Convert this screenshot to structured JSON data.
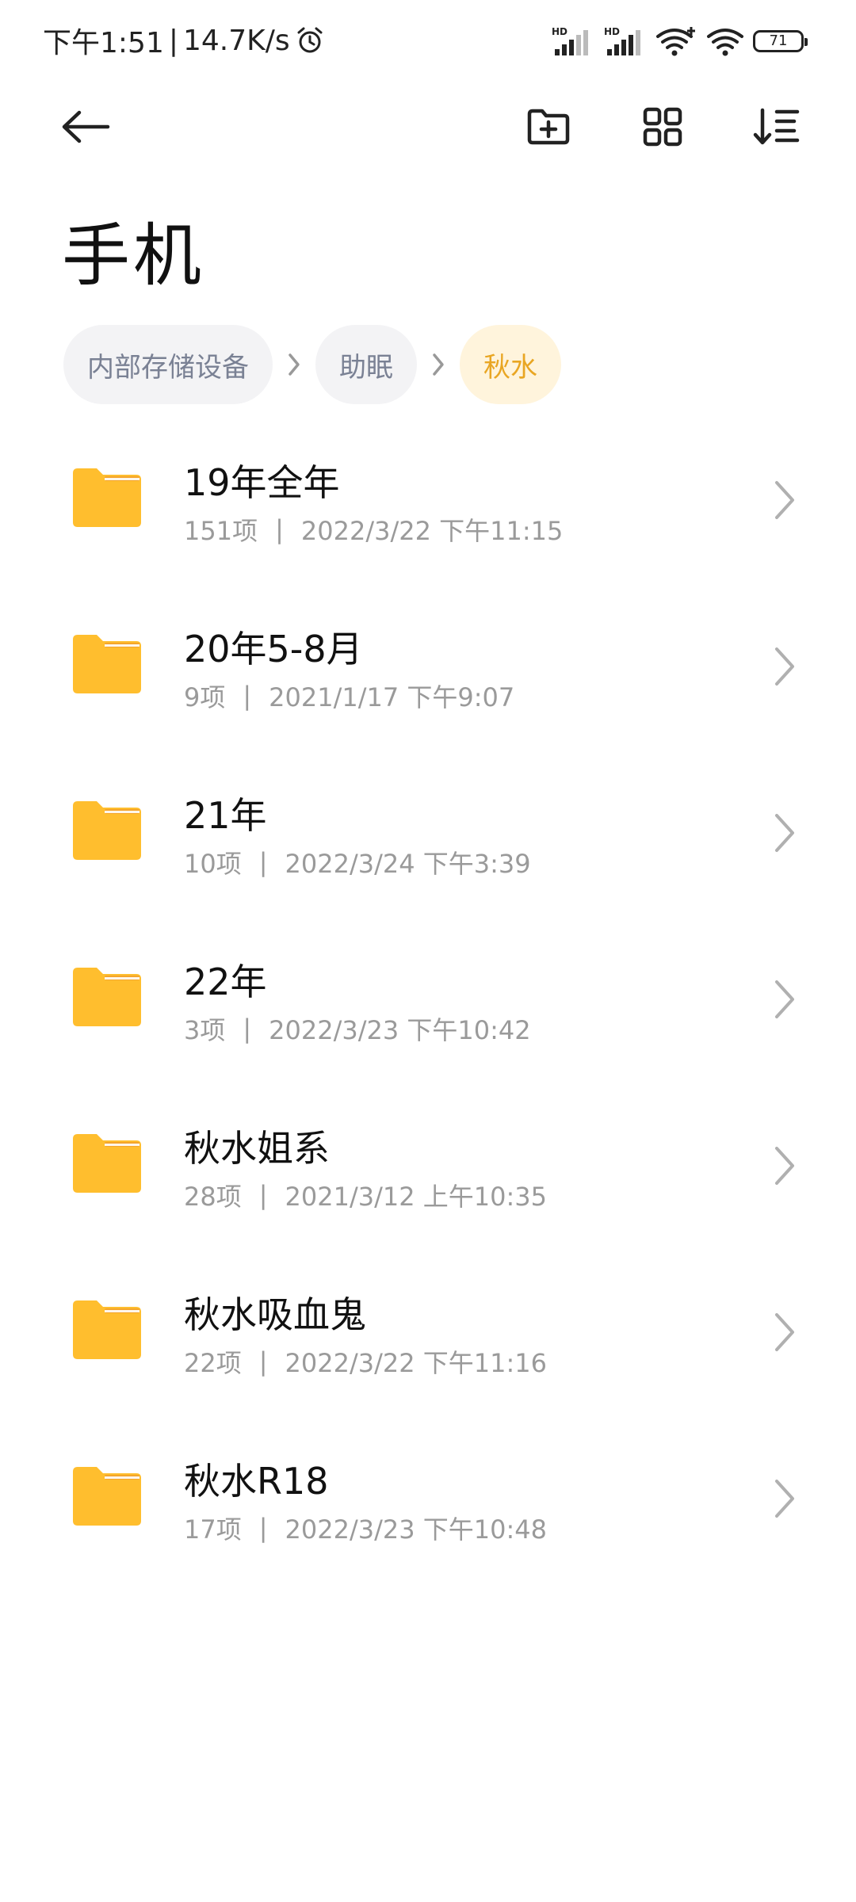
{
  "status_bar": {
    "time": "下午1:51",
    "separator": "|",
    "network_speed": "14.7K/s",
    "alarm_icon": "alarm-clock-icon",
    "signal_label_1": "HD",
    "signal_label_2": "HD",
    "battery_level": "71"
  },
  "toolbar": {
    "back_icon": "arrow-left-icon",
    "new_folder_icon": "folder-plus-icon",
    "grid_icon": "grid-view-icon",
    "sort_icon": "sort-list-icon"
  },
  "title": "手机",
  "breadcrumb": [
    {
      "label": "内部存储设备",
      "active": false
    },
    {
      "label": "助眠",
      "active": false
    },
    {
      "label": "秋水",
      "active": true
    }
  ],
  "colors": {
    "folder": "#FFBE2E",
    "folder_tab": "#F4A52B",
    "accent": "#E9A623",
    "crumb_bg": "#F3F3F5",
    "crumb_active_bg": "#FFF4DC"
  },
  "meta_separator": "|",
  "folders": [
    {
      "name": "19年全年",
      "count": "151项",
      "modified": "2022/3/22 下午11:15"
    },
    {
      "name": "20年5-8月",
      "count": "9项",
      "modified": "2021/1/17 下午9:07"
    },
    {
      "name": "21年",
      "count": "10项",
      "modified": "2022/3/24 下午3:39"
    },
    {
      "name": "22年",
      "count": "3项",
      "modified": "2022/3/23 下午10:42"
    },
    {
      "name": "秋水姐系",
      "count": "28项",
      "modified": "2021/3/12 上午10:35"
    },
    {
      "name": "秋水吸血鬼",
      "count": "22项",
      "modified": "2022/3/22 下午11:16"
    },
    {
      "name": "秋水R18",
      "count": "17项",
      "modified": "2022/3/23 下午10:48"
    }
  ]
}
